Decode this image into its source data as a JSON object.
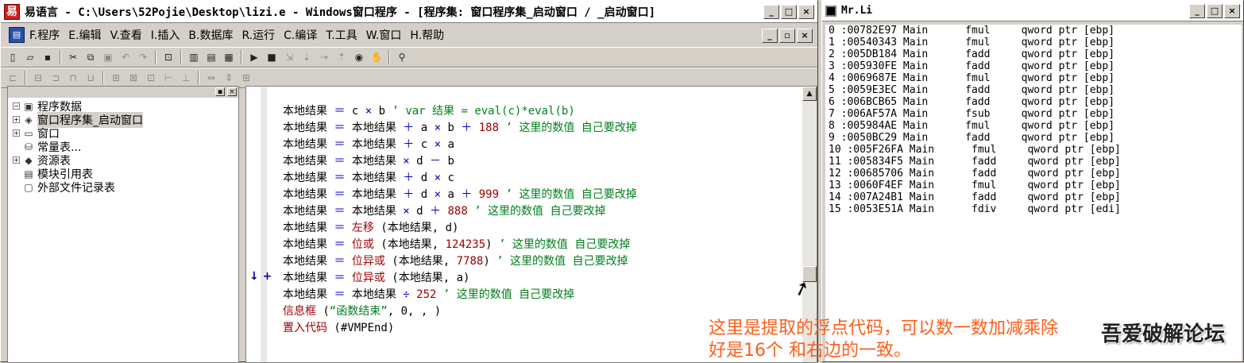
{
  "left_window": {
    "title": "易语言 - C:\\Users\\52Pojie\\Desktop\\lizi.e - Windows窗口程序 - [程序集: 窗口程序集_启动窗口 / _启动窗口]",
    "caption_buttons": [
      "_",
      "□",
      "×"
    ],
    "menu": [
      "F.程序",
      "E.编辑",
      "V.查看",
      "I.插入",
      "B.数据库",
      "R.运行",
      "C.编译",
      "T.工具",
      "W.窗口",
      "H.帮助"
    ],
    "mdi_buttons": [
      "_",
      "▫",
      "×"
    ]
  },
  "tree": {
    "items": [
      {
        "label": "程序数据",
        "exp": "−",
        "icon": "folder-icon",
        "glyph": "▣"
      },
      {
        "label": "窗口程序集_启动窗口",
        "exp": "+",
        "icon": "stack-icon",
        "glyph": "◈"
      },
      {
        "label": "窗口",
        "exp": "+",
        "icon": "window-icon",
        "glyph": "▭"
      },
      {
        "label": "常量表...",
        "exp": "",
        "icon": "database-icon",
        "glyph": "⛁"
      },
      {
        "label": "资源表",
        "exp": "+",
        "icon": "resource-icon",
        "glyph": "◆"
      },
      {
        "label": "模块引用表",
        "exp": "",
        "icon": "module-icon",
        "glyph": "▤"
      },
      {
        "label": "外部文件记录表",
        "exp": "",
        "icon": "file-icon",
        "glyph": "▢"
      }
    ]
  },
  "code": {
    "lines": [
      [
        [
          "v",
          "本地结果 "
        ],
        [
          "o",
          "＝"
        ],
        [
          "v",
          " c "
        ],
        [
          "o",
          "×"
        ],
        [
          "v",
          " b  "
        ],
        [
          "c",
          "’ var 结果 = eval(c)*eval(b)"
        ]
      ],
      [
        [
          "v",
          "本地结果 "
        ],
        [
          "o",
          "＝"
        ],
        [
          "v",
          " 本地结果 "
        ],
        [
          "o",
          "＋"
        ],
        [
          "v",
          " a "
        ],
        [
          "o",
          "×"
        ],
        [
          "v",
          " b "
        ],
        [
          "o",
          "＋"
        ],
        [
          "n",
          " 188"
        ],
        [
          "c",
          "  ’ 这里的数值  自己要改掉"
        ]
      ],
      [
        [
          "v",
          "本地结果 "
        ],
        [
          "o",
          "＝"
        ],
        [
          "v",
          " 本地结果 "
        ],
        [
          "o",
          "＋"
        ],
        [
          "v",
          " c "
        ],
        [
          "o",
          "×"
        ],
        [
          "v",
          " a"
        ]
      ],
      [
        [
          "v",
          "本地结果 "
        ],
        [
          "o",
          "＝"
        ],
        [
          "v",
          " 本地结果 "
        ],
        [
          "o",
          "×"
        ],
        [
          "v",
          " d "
        ],
        [
          "o",
          "－"
        ],
        [
          "v",
          " b"
        ]
      ],
      [
        [
          "v",
          "本地结果 "
        ],
        [
          "o",
          "＝"
        ],
        [
          "v",
          " 本地结果 "
        ],
        [
          "o",
          "＋"
        ],
        [
          "v",
          " d "
        ],
        [
          "o",
          "×"
        ],
        [
          "v",
          " c"
        ]
      ],
      [
        [
          "v",
          "本地结果 "
        ],
        [
          "o",
          "＝"
        ],
        [
          "v",
          " 本地结果 "
        ],
        [
          "o",
          "＋"
        ],
        [
          "v",
          " d "
        ],
        [
          "o",
          "×"
        ],
        [
          "v",
          " a "
        ],
        [
          "o",
          "＋"
        ],
        [
          "n",
          " 999"
        ],
        [
          "c",
          "  ’ 这里的数值  自己要改掉"
        ]
      ],
      [
        [
          "v",
          "本地结果 "
        ],
        [
          "o",
          "＝"
        ],
        [
          "v",
          " 本地结果 "
        ],
        [
          "o",
          "×"
        ],
        [
          "v",
          " d "
        ],
        [
          "o",
          "＋"
        ],
        [
          "n",
          " 888"
        ],
        [
          "c",
          "  ’ 这里的数值  自己要改掉"
        ]
      ],
      [
        [
          "v",
          "本地结果 "
        ],
        [
          "o",
          "＝"
        ],
        [
          "k",
          " 左移"
        ],
        [
          "v",
          " (本地结果, d)"
        ]
      ],
      [
        [
          "v",
          "本地结果 "
        ],
        [
          "o",
          "＝"
        ],
        [
          "k",
          " 位或"
        ],
        [
          "v",
          " (本地结果, "
        ],
        [
          "n",
          "124235"
        ],
        [
          "v",
          ")"
        ],
        [
          "c",
          "  ’ 这里的数值  自己要改掉"
        ]
      ],
      [
        [
          "v",
          "本地结果 "
        ],
        [
          "o",
          "＝"
        ],
        [
          "k",
          " 位异或"
        ],
        [
          "v",
          " (本地结果, "
        ],
        [
          "n",
          "7788"
        ],
        [
          "v",
          ")"
        ],
        [
          "c",
          "  ’ 这里的数值  自己要改掉"
        ]
      ],
      [
        [
          "v",
          "本地结果 "
        ],
        [
          "o",
          "＝"
        ],
        [
          "k",
          " 位异或"
        ],
        [
          "v",
          " (本地结果, a)"
        ]
      ],
      [
        [
          "v",
          "本地结果 "
        ],
        [
          "o",
          "＝"
        ],
        [
          "v",
          " 本地结果 "
        ],
        [
          "o",
          "÷"
        ],
        [
          "n",
          " 252"
        ],
        [
          "c",
          "  ’ 这里的数值  自己要改掉"
        ]
      ],
      [
        [
          "k",
          "信息框"
        ],
        [
          "v",
          " ("
        ],
        [
          "c",
          "“函数结束”"
        ],
        [
          "v",
          ", 0, , )"
        ]
      ],
      [
        [
          "k",
          "置入代码"
        ],
        [
          "v",
          " (#VMPEnd)"
        ]
      ]
    ],
    "exec_marker": "↓ +"
  },
  "right_window": {
    "title": "Mr.Li",
    "caption_buttons": [
      "_",
      "□",
      "×"
    ],
    "rows": [
      "0 :00782E97 Main      fmul     qword ptr [ebp]",
      "1 :00540343 Main      fmul     qword ptr [ebp]",
      "2 :005DB184 Main      fadd     qword ptr [ebp]",
      "3 :005930FE Main      fadd     qword ptr [ebp]",
      "4 :0069687E Main      fmul     qword ptr [ebp]",
      "5 :0059E3EC Main      fadd     qword ptr [ebp]",
      "6 :006BCB65 Main      fadd     qword ptr [ebp]",
      "7 :006AF57A Main      fsub     qword ptr [ebp]",
      "8 :005984AE Main      fmul     qword ptr [ebp]",
      "9 :0050BC29 Main      fadd     qword ptr [ebp]",
      "10 :005F26FA Main      fmul     qword ptr [ebp]",
      "11 :005834F5 Main      fadd     qword ptr [ebp]",
      "12 :00685706 Main      fadd     qword ptr [ebp]",
      "13 :0060F4EF Main      fmul     qword ptr [ebp]",
      "14 :007A24B1 Main      fadd     qword ptr [ebp]",
      "15 :0053E51A Main      fdiv     qword ptr [edi]"
    ]
  },
  "overlay": {
    "line1": "这里是提取的浮点代码，可以数一数加减乘除",
    "line2": "好是16个  和右边的一致。",
    "watermark": "吾爱破解论坛"
  }
}
